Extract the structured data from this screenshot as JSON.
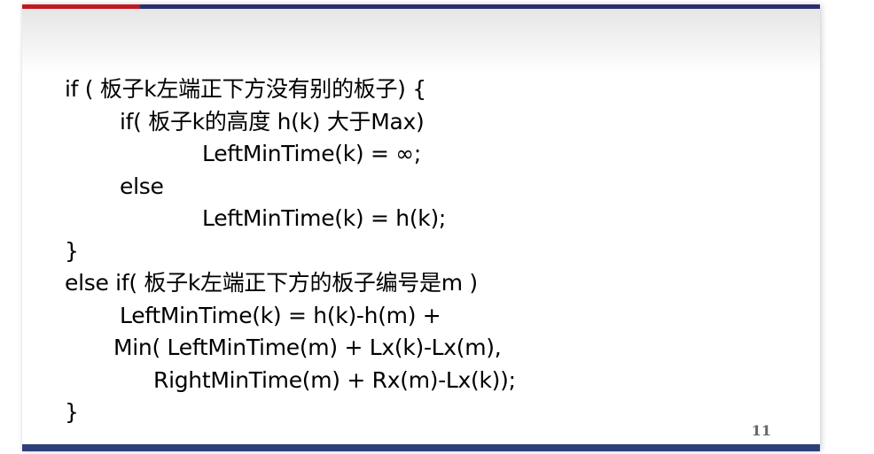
{
  "slide": {
    "page_number": "11",
    "colors": {
      "top_bar_red": "#c0191f",
      "top_bar_navy": "#2b2f6e",
      "bottom_bar": "#2e3f7a",
      "text": "#000000",
      "page_number": "#666666"
    },
    "code_lines": [
      "if ( 板子k左端正下方没有别的板子) {",
      "if( 板子k的高度 h(k) 大于Max)",
      "LeftMinTime(k) = ∞;",
      "else",
      "LeftMinTime(k) = h(k);",
      "}",
      "else if( 板子k左端正下方的板子编号是m )",
      "LeftMinTime(k) = h(k)-h(m) +",
      "Min( LeftMinTime(m) + Lx(k)-Lx(m),",
      "RightMinTime(m) + Rx(m)-Lx(k));",
      "}"
    ]
  }
}
